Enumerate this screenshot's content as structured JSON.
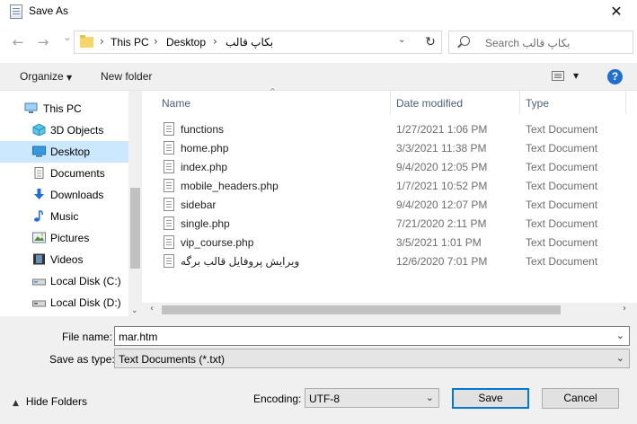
{
  "window": {
    "title": "Save As",
    "close_label": "✕"
  },
  "nav": {
    "back": "←",
    "forward": "→",
    "recent": "⌄",
    "refresh": "↻"
  },
  "address": {
    "segments": [
      "This PC",
      "Desktop",
      "بکاپ قالب"
    ],
    "separator": "›"
  },
  "search": {
    "placeholder": "Search بکاپ قالب"
  },
  "toolbar": {
    "organize": "Organize",
    "new_folder": "New folder",
    "help": "?"
  },
  "sidebar": {
    "items": [
      {
        "label": "This PC",
        "icon": "computer-icon"
      },
      {
        "label": "3D Objects",
        "icon": "cube-icon"
      },
      {
        "label": "Desktop",
        "icon": "desktop-icon",
        "selected": true
      },
      {
        "label": "Documents",
        "icon": "documents-icon"
      },
      {
        "label": "Downloads",
        "icon": "download-arrow-icon"
      },
      {
        "label": "Music",
        "icon": "music-note-icon"
      },
      {
        "label": "Pictures",
        "icon": "pictures-icon"
      },
      {
        "label": "Videos",
        "icon": "film-icon"
      },
      {
        "label": "Local Disk (C:)",
        "icon": "drive-icon"
      },
      {
        "label": "Local Disk (D:)",
        "icon": "drive-icon"
      }
    ]
  },
  "files": {
    "columns": [
      "Name",
      "Date modified",
      "Type"
    ],
    "rows": [
      {
        "name": "functions",
        "date": "1/27/2021 1:06 PM",
        "type": "Text Document"
      },
      {
        "name": "home.php",
        "date": "3/3/2021 11:38 PM",
        "type": "Text Document"
      },
      {
        "name": "index.php",
        "date": "9/4/2020 12:05 PM",
        "type": "Text Document"
      },
      {
        "name": "mobile_headers.php",
        "date": "1/7/2021 10:52 PM",
        "type": "Text Document"
      },
      {
        "name": "sidebar",
        "date": "9/4/2020 12:07 PM",
        "type": "Text Document"
      },
      {
        "name": "single.php",
        "date": "7/21/2020 2:11 PM",
        "type": "Text Document"
      },
      {
        "name": "vip_course.php",
        "date": "3/5/2021 1:01 PM",
        "type": "Text Document"
      },
      {
        "name": "ویرایش پروفایل قالب برگه",
        "date": "12/6/2020 7:01 PM",
        "type": "Text Document"
      }
    ]
  },
  "form": {
    "file_name_label": "File name:",
    "file_name_value": "mar.htm",
    "save_type_label": "Save as type:",
    "save_type_value": "Text Documents (*.txt)",
    "encoding_label": "Encoding:",
    "encoding_value": "UTF-8",
    "hide_folders": "Hide Folders",
    "save": "Save",
    "cancel": "Cancel"
  }
}
